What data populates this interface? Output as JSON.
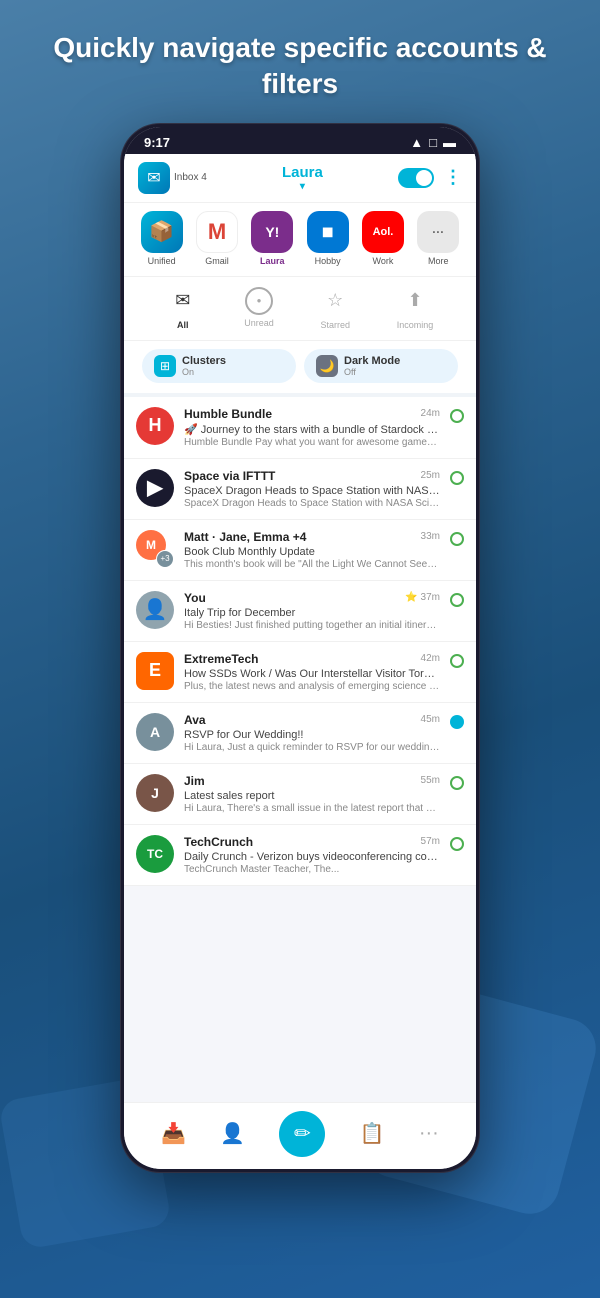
{
  "page": {
    "header": "Quickly navigate specific accounts & filters"
  },
  "status_bar": {
    "time": "9:17",
    "wifi": "▲",
    "battery": "🔋"
  },
  "app_header": {
    "inbox_label": "Inbox 4",
    "account_name": "Laura",
    "chevron": "▾"
  },
  "accounts": [
    {
      "id": "unified",
      "label": "Unified",
      "icon": "📦",
      "bg": "unified"
    },
    {
      "id": "gmail",
      "label": "Gmail",
      "icon": "M",
      "bg": "gmail"
    },
    {
      "id": "laura",
      "label": "Laura",
      "icon": "Y!",
      "bg": "laura",
      "active": true
    },
    {
      "id": "hobby",
      "label": "Hobby",
      "icon": "◼",
      "bg": "outlook"
    },
    {
      "id": "work",
      "label": "Work",
      "icon": "Aol.",
      "bg": "aol"
    },
    {
      "id": "more",
      "label": "More",
      "icon": "···",
      "bg": "more"
    }
  ],
  "filters": [
    {
      "id": "all",
      "label": "All",
      "icon": "✉",
      "active": true
    },
    {
      "id": "unread",
      "label": "Unread",
      "icon": "◎",
      "active": false
    },
    {
      "id": "starred",
      "label": "Starred",
      "icon": "☆",
      "active": false
    },
    {
      "id": "incoming",
      "label": "Incoming",
      "icon": "⬆",
      "active": false
    }
  ],
  "settings": [
    {
      "id": "clusters",
      "icon": "+",
      "label": "Clusters",
      "sub": "On"
    },
    {
      "id": "dark_mode",
      "icon": "🌙",
      "label": "Dark Mode",
      "sub": "Off"
    }
  ],
  "emails": [
    {
      "id": "humble",
      "sender": "Humble Bundle",
      "time": "24m",
      "subject": "🚀 Journey to the stars with a bundle of Stardock strategy ...",
      "preview": "Humble Bundle Pay what you want for awesome games a...",
      "avatar_type": "letter",
      "avatar_letter": "H",
      "avatar_class": "avatar-humble",
      "indicator": "dot-green"
    },
    {
      "id": "space",
      "sender": "Space via IFTTT",
      "time": "25m",
      "subject": "SpaceX Dragon Heads to Space Station with NASA Scienc...",
      "preview": "SpaceX Dragon Heads to Space Station with NASA Scienc...",
      "avatar_type": "shape",
      "avatar_class": "avatar-space",
      "avatar_letter": "▶",
      "indicator": "dot-green"
    },
    {
      "id": "matt",
      "sender": "Matt · Jane, Emma +4",
      "time": "33m",
      "subject": "Book Club Monthly Update",
      "preview": "This month's book will be \"All the Light We Cannot See\" by ...",
      "avatar_type": "multi",
      "indicator": "dot-green"
    },
    {
      "id": "you",
      "sender": "You",
      "time": "37m",
      "subject": "Italy Trip for December",
      "preview": "Hi Besties! Just finished putting together an initial itinerary...",
      "avatar_type": "letter",
      "avatar_letter": "👤",
      "avatar_class": "avatar-you",
      "indicator": "star-dot-green",
      "starred": true
    },
    {
      "id": "extreme",
      "sender": "ExtremeTech",
      "time": "42m",
      "subject": "How SSDs Work / Was Our Interstellar Visitor Torn Apart b...",
      "preview": "Plus, the latest news and analysis of emerging science an...",
      "avatar_type": "letter",
      "avatar_letter": "E",
      "avatar_class": "avatar-extreme",
      "indicator": "dot-green"
    },
    {
      "id": "ava",
      "sender": "Ava",
      "time": "45m",
      "subject": "RSVP for Our Wedding!!",
      "preview": "Hi Laura, Just a quick reminder to RSVP for our wedding. I'll nee...",
      "avatar_type": "letter",
      "avatar_letter": "A",
      "avatar_class": "avatar-ava",
      "indicator": "dot-teal"
    },
    {
      "id": "jim",
      "sender": "Jim",
      "time": "55m",
      "subject": "Latest sales report",
      "preview": "Hi Laura, There's a small issue in the latest report that was...",
      "avatar_type": "letter",
      "avatar_letter": "J",
      "avatar_class": "avatar-jim",
      "indicator": "dot-green"
    },
    {
      "id": "tc",
      "sender": "TechCrunch",
      "time": "57m",
      "subject": "Daily Crunch - Verizon buys videoconferencing company B...",
      "preview": "TechCrunch Master Teacher, The...",
      "avatar_type": "letter",
      "avatar_letter": "TC",
      "avatar_class": "avatar-tc",
      "indicator": "dot-green"
    }
  ],
  "bottom_nav": [
    {
      "id": "inbox",
      "icon": "📥",
      "active": true
    },
    {
      "id": "contacts",
      "icon": "👤",
      "active": false
    },
    {
      "id": "compose",
      "icon": "✏",
      "active": false,
      "special": true
    },
    {
      "id": "tasks",
      "icon": "📋",
      "active": false
    },
    {
      "id": "more",
      "icon": "···",
      "active": false
    }
  ]
}
